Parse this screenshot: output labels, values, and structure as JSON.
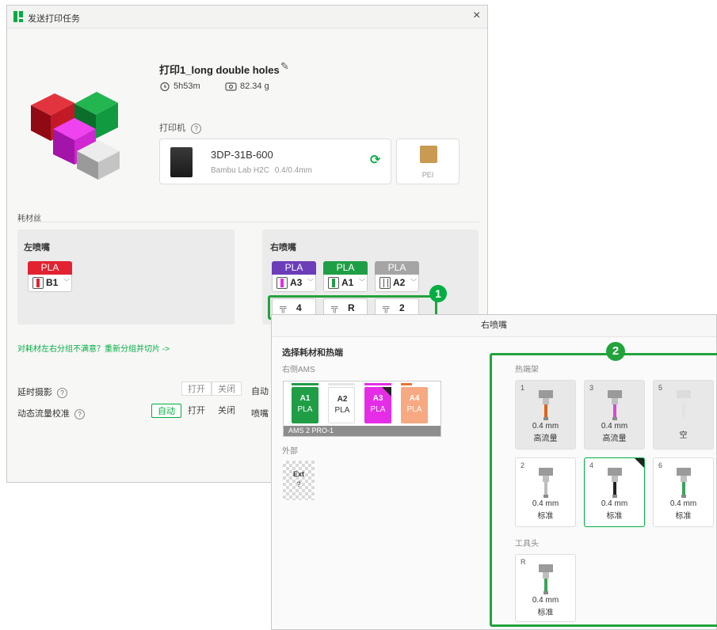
{
  "window": {
    "title": "发送打印任务",
    "close": "×"
  },
  "job": {
    "title": "打印1_long double holes",
    "time": "5h53m",
    "weight": "82.34 g"
  },
  "printer": {
    "label": "打印机",
    "help": "?",
    "name": "3DP-31B-600",
    "model": "Bambu Lab H2C",
    "nozzle": "0.4/0.4mm",
    "plate": "PEI"
  },
  "filament": {
    "section_label": "耗材丝",
    "left": {
      "title": "左喷嘴",
      "chips": [
        {
          "type": "PLA",
          "slot": "B1",
          "color": "#e22231"
        }
      ]
    },
    "right": {
      "title": "右喷嘴",
      "chips": [
        {
          "type": "PLA",
          "slot": "A3",
          "color": "#6b3db8",
          "spool": "#e52de8",
          "nozzle": "4"
        },
        {
          "type": "PLA",
          "slot": "A1",
          "color": "#1f9e46",
          "spool": "#1f9e46",
          "nozzle": "R"
        },
        {
          "type": "PLA",
          "slot": "A2",
          "color": "#a5a5a5",
          "spool": "#ffffff",
          "nozzle": "2"
        }
      ]
    },
    "badge": "1",
    "regroup_link": "对耗材左右分组不满意？重新分组并切片 ->"
  },
  "options": {
    "timelapse": {
      "label": "延时摄影",
      "on": "打开",
      "off": "关闭"
    },
    "flow_cal": {
      "label": "动态流量校准",
      "auto": "自动",
      "on": "打开",
      "off": "关闭"
    },
    "cut1": "自动",
    "cut2": "喷嘴"
  },
  "overlay": {
    "title": "右喷嘴",
    "select_label": "选择耗材和热端",
    "ams_label": "右侧AMS",
    "ams_name": "AMS 2 PRO-1",
    "ams_slots": [
      {
        "name": "A1",
        "type": "PLA",
        "bg": "#1f9e46",
        "fg": "#ffffff",
        "bar": "#1f9e46"
      },
      {
        "name": "A2",
        "type": "PLA",
        "bg": "#ffffff",
        "fg": "#333333",
        "bar": "#ffffff"
      },
      {
        "name": "A3",
        "type": "PLA",
        "bg": "#e52de8",
        "fg": "#ffffff",
        "bar": "#e52de8"
      },
      {
        "name": "A4",
        "type": "PLA",
        "bg": "#f7a982",
        "fg": "#ffffff",
        "bar": "#e8742f"
      }
    ],
    "external_label": "外部",
    "external": {
      "name": "Ext",
      "value": "?"
    },
    "badge": "2",
    "rack_label": "热端架",
    "toolhead_label": "工具头",
    "rack": [
      {
        "num": "1",
        "size": "0.4 mm",
        "type": "高流量",
        "color": "#e0621b"
      },
      {
        "num": "3",
        "size": "0.4 mm",
        "type": "高流量",
        "color": "#d44bd4"
      },
      {
        "num": "5",
        "size": "",
        "type": "空",
        "color": "#cfcfcf"
      },
      {
        "num": "2",
        "size": "0.4 mm",
        "type": "标准",
        "color": "#bdbdbd"
      },
      {
        "num": "4",
        "size": "0.4 mm",
        "type": "标准",
        "color": "#222222"
      },
      {
        "num": "6",
        "size": "0.4 mm",
        "type": "标准",
        "color": "#3aa35a"
      }
    ],
    "toolhead": {
      "num": "R",
      "size": "0.4 mm",
      "type": "标准",
      "color": "#3aa35a"
    }
  }
}
